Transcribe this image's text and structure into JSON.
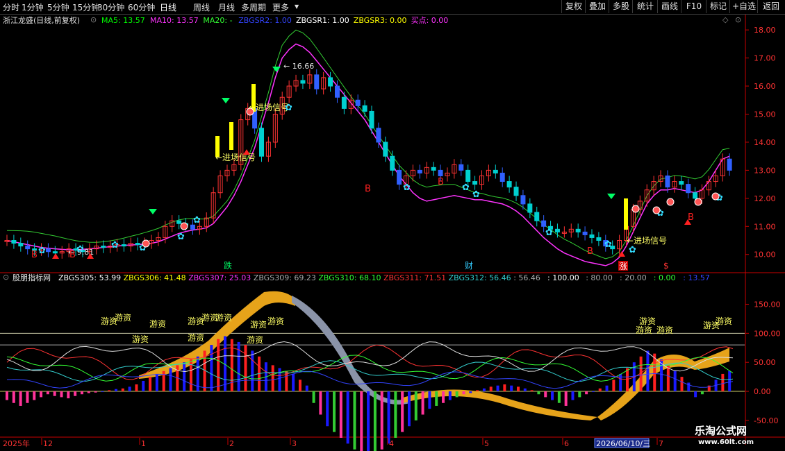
{
  "toolbar": {
    "periods": [
      "分时",
      "1分钟",
      "5分钟",
      "15分钟",
      "30分钟",
      "60分钟",
      "日线",
      "周线",
      "月线",
      "多周期",
      "更多"
    ],
    "active_period": "日线",
    "more_marker": "▼",
    "buttons": [
      "复权",
      "叠加",
      "多股",
      "统计",
      "画线",
      "F10",
      "标记",
      "+自选",
      "返回"
    ]
  },
  "main": {
    "title": "浙江龙盛(日线,前复权)",
    "indicators": [
      {
        "label": "MA5: 13.57",
        "color": "#00ff00"
      },
      {
        "label": "MA10: 13.57",
        "color": "#ff33ff"
      },
      {
        "label": "MA20: -",
        "color": "#33ff33"
      },
      {
        "label": "ZBGSR2: 1.00",
        "color": "#3344ff"
      },
      {
        "label": "ZBGSR1: 1.00",
        "color": "#ffffff"
      },
      {
        "label": "ZBGSR3: 0.00",
        "color": "#ffff00"
      },
      {
        "label": "买点: 0.00",
        "color": "#ff33ff"
      }
    ],
    "price_axis": [
      "18.00",
      "17.00",
      "16.00",
      "15.00",
      "14.00",
      "13.00",
      "12.00",
      "11.00",
      "10.00"
    ],
    "peak_label": "16.66",
    "low_label": "9.81",
    "signals": [
      "进场信号",
      "进场信号",
      "进场信号"
    ],
    "event_labels": [
      "跌",
      "财",
      "涨",
      "$"
    ]
  },
  "sub": {
    "title": "股朋指标网",
    "indicators": [
      {
        "label": "ZBGS305: 53.99",
        "color": "#ffffff"
      },
      {
        "label": "ZBGS306: 41.48",
        "color": "#ffff00"
      },
      {
        "label": "ZBGS307: 25.03",
        "color": "#ff33ff"
      },
      {
        "label": "ZBGS309: 69.23",
        "color": "#aaaaaa"
      },
      {
        "label": "ZBGS310: 68.10",
        "color": "#33ff33"
      },
      {
        "label": "ZBGS311: 71.51",
        "color": "#ff3333"
      },
      {
        "label": "ZBGS312: 56.46",
        "color": "#33cccc"
      },
      {
        "label": ": 56.46",
        "color": "#aaaaaa"
      },
      {
        "label": ": 100.00",
        "color": "#ffffff"
      },
      {
        "label": ": 80.00",
        "color": "#aaaaaa"
      },
      {
        "label": ": 20.00",
        "color": "#aaaaaa"
      },
      {
        "label": ": 0.00",
        "color": "#33ff33"
      },
      {
        "label": ": 13.57",
        "color": "#3344ff"
      }
    ],
    "axis": [
      "150.00",
      "100.00",
      "50.00",
      "0.00",
      "-50.00"
    ],
    "tag": "游资"
  },
  "date_axis": {
    "year": "2025年",
    "months": [
      "12",
      "1",
      "2",
      "3",
      "4",
      "5",
      "6",
      "7"
    ],
    "cursor_date": "2026/06/10/三"
  },
  "watermark": {
    "brand": "乐淘公式网",
    "url": "www.60lt.com"
  },
  "colors": {
    "up": "#ff3333",
    "down": "#00ffff",
    "ma5": "#00ff00",
    "ma10": "#ff33ff",
    "axis": "#cc0000",
    "bar_red": "#ff2020",
    "bar_blue": "#1a1aff",
    "bar_pink": "#ff3399",
    "bar_green": "#33cc33",
    "gold": "#e6a31a",
    "slate": "#8a93a8"
  },
  "chart_data": {
    "type": "candlestick",
    "price_ylim": [
      9.4,
      18.3
    ],
    "close": [
      10.5,
      10.4,
      10.3,
      10.2,
      10.15,
      10.2,
      10.1,
      10.05,
      10.1,
      10.2,
      10.15,
      10.1,
      10.2,
      10.3,
      10.25,
      10.3,
      10.35,
      10.3,
      10.4,
      10.35,
      10.4,
      10.5,
      10.6,
      11.0,
      11.2,
      11.1,
      11.05,
      10.9,
      11.0,
      11.3,
      12.2,
      12.8,
      13.0,
      13.2,
      14.8,
      15.2,
      14.5,
      13.5,
      14.0,
      15.0,
      15.6,
      16.0,
      16.2,
      16.1,
      16.4,
      15.9,
      16.3,
      16.0,
      15.6,
      15.2,
      15.5,
      15.3,
      15.1,
      14.5,
      14.0,
      13.5,
      13.0,
      12.5,
      12.8,
      13.0,
      12.9,
      13.1,
      13.0,
      12.8,
      12.9,
      13.2,
      13.0,
      12.6,
      12.5,
      12.8,
      13.0,
      12.9,
      12.6,
      12.4,
      12.1,
      11.8,
      11.5,
      11.2,
      11.0,
      10.9,
      10.8,
      10.8,
      10.9,
      10.8,
      10.7,
      10.6,
      10.5,
      10.3,
      10.2,
      10.5,
      11.0,
      11.6,
      11.9,
      12.3,
      12.6,
      12.8,
      12.4,
      12.6,
      12.5,
      12.2,
      12.0,
      12.3,
      12.6,
      12.8,
      13.4,
      13.0
    ],
    "ma10": [
      10.5,
      10.45,
      10.4,
      10.35,
      10.3,
      10.25,
      10.22,
      10.2,
      10.18,
      10.17,
      10.17,
      10.18,
      10.2,
      10.22,
      10.25,
      10.28,
      10.3,
      10.32,
      10.34,
      10.35,
      10.37,
      10.4,
      10.45,
      10.55,
      10.65,
      10.75,
      10.82,
      10.87,
      10.9,
      10.95,
      11.1,
      11.4,
      11.7,
      12.1,
      12.6,
      13.2,
      13.8,
      14.6,
      15.4,
      16.3,
      17.0,
      17.3,
      17.5,
      17.4,
      17.2,
      16.9,
      16.6,
      16.3,
      16.0,
      15.7,
      15.4,
      15.1,
      14.8,
      14.4,
      14.0,
      13.6,
      13.2,
      12.8,
      12.5,
      12.2,
      12.0,
      11.9,
      11.95,
      12.0,
      12.05,
      12.1,
      12.05,
      12.0,
      11.95,
      11.95,
      11.9,
      11.85,
      11.8,
      11.7,
      11.55,
      11.35,
      11.1,
      10.85,
      10.6,
      10.4,
      10.2,
      10.05,
      9.95,
      9.85,
      9.75,
      9.7,
      9.65,
      9.6,
      9.7,
      9.9,
      10.3,
      10.8,
      11.3,
      11.8,
      12.1,
      12.3,
      12.3,
      12.35,
      12.3,
      12.25,
      12.2,
      12.3,
      12.6,
      13.0,
      13.4,
      13.5
    ],
    "sub_ylim": [
      -80,
      190
    ],
    "sub_bars": [
      -15,
      -20,
      -25,
      -20,
      -15,
      -10,
      -5,
      -8,
      -10,
      -12,
      -8,
      -5,
      -3,
      -2,
      0,
      2,
      4,
      5,
      8,
      12,
      18,
      25,
      30,
      35,
      40,
      45,
      50,
      55,
      60,
      70,
      80,
      90,
      95,
      90,
      85,
      80,
      70,
      60,
      50,
      45,
      40,
      35,
      30,
      20,
      10,
      -20,
      -40,
      -60,
      -70,
      -80,
      -90,
      -100,
      -110,
      -120,
      -110,
      -100,
      -90,
      -80,
      -70,
      -60,
      -50,
      -40,
      -30,
      -25,
      -20,
      -15,
      -10,
      -5,
      -3,
      2,
      5,
      8,
      10,
      12,
      10,
      8,
      5,
      2,
      -5,
      -10,
      -15,
      -20,
      -25,
      -15,
      -10,
      -5,
      0,
      5,
      10,
      20,
      30,
      40,
      50,
      60,
      70,
      65,
      55,
      45,
      35,
      25,
      15,
      -10,
      -5,
      10,
      20,
      30,
      35
    ]
  }
}
